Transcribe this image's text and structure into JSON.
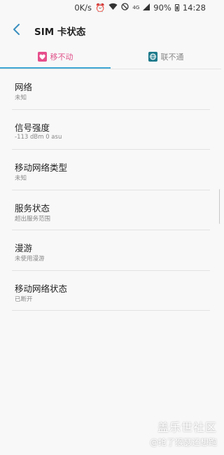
{
  "status_bar": {
    "speed": "0K/s",
    "network_type": "4G",
    "battery": "90%",
    "time": "14:28"
  },
  "header": {
    "title": "SIM 卡状态"
  },
  "tabs": [
    {
      "label": "移不动",
      "active": true
    },
    {
      "label": "联不通",
      "active": false
    }
  ],
  "items": [
    {
      "label": "网络",
      "value": "未知"
    },
    {
      "label": "信号强度",
      "value": "-113 dBm 0 asu"
    },
    {
      "label": "移动网络类型",
      "value": "未知"
    },
    {
      "label": "服务状态",
      "value": "超出服务范围"
    },
    {
      "label": "漫游",
      "value": "未使用漫游"
    },
    {
      "label": "移动网络状态",
      "value": "已断开"
    }
  ],
  "watermark": {
    "line1": "盖乐世社区",
    "line2": "@抢了猴瑟还想跑"
  },
  "colors": {
    "tab_active": "#e0538a",
    "tab_underline": "#3fa6d4",
    "tab2_icon": "#1d7a8b"
  }
}
